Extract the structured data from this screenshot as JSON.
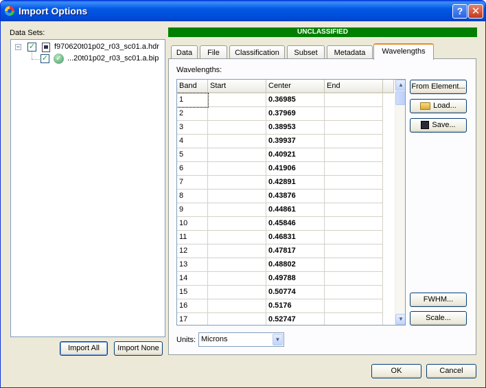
{
  "window": {
    "title": "Import Options",
    "help_glyph": "?",
    "close_glyph": "✕"
  },
  "datasets": {
    "label": "Data Sets:",
    "parent": {
      "name": "f970620t01p02_r03_sc01.a.hdr",
      "checked": true
    },
    "child": {
      "name": "...20t01p02_r03_sc01.a.bip",
      "checked": true
    },
    "import_all": "Import All",
    "import_none": "Import None"
  },
  "banner": "UNCLASSIFIED",
  "tabs": [
    "Data",
    "File",
    "Classification",
    "Subset",
    "Metadata",
    "Wavelengths"
  ],
  "active_tab": "Wavelengths",
  "wavelengths": {
    "label": "Wavelengths:",
    "columns": [
      "Band",
      "Start",
      "Center",
      "End"
    ],
    "rows": [
      {
        "band": "1",
        "start": "",
        "center": "0.36985",
        "end": ""
      },
      {
        "band": "2",
        "start": "",
        "center": "0.37969",
        "end": ""
      },
      {
        "band": "3",
        "start": "",
        "center": "0.38953",
        "end": ""
      },
      {
        "band": "4",
        "start": "",
        "center": "0.39937",
        "end": ""
      },
      {
        "band": "5",
        "start": "",
        "center": "0.40921",
        "end": ""
      },
      {
        "band": "6",
        "start": "",
        "center": "0.41906",
        "end": ""
      },
      {
        "band": "7",
        "start": "",
        "center": "0.42891",
        "end": ""
      },
      {
        "band": "8",
        "start": "",
        "center": "0.43876",
        "end": ""
      },
      {
        "band": "9",
        "start": "",
        "center": "0.44861",
        "end": ""
      },
      {
        "band": "10",
        "start": "",
        "center": "0.45846",
        "end": ""
      },
      {
        "band": "11",
        "start": "",
        "center": "0.46831",
        "end": ""
      },
      {
        "band": "12",
        "start": "",
        "center": "0.47817",
        "end": ""
      },
      {
        "band": "13",
        "start": "",
        "center": "0.48802",
        "end": ""
      },
      {
        "band": "14",
        "start": "",
        "center": "0.49788",
        "end": ""
      },
      {
        "band": "15",
        "start": "",
        "center": "0.50774",
        "end": ""
      },
      {
        "band": "16",
        "start": "",
        "center": "0.5176",
        "end": ""
      },
      {
        "band": "17",
        "start": "",
        "center": "0.52747",
        "end": ""
      }
    ],
    "from_element": "From Element...",
    "load": "Load...",
    "save": "Save...",
    "fwhm": "FWHM...",
    "scale": "Scale...",
    "units_label": "Units:",
    "units_value": "Microns"
  },
  "footer": {
    "ok": "OK",
    "cancel": "Cancel"
  },
  "colors": {
    "banner": "#008000",
    "title_bar": "#0058e6",
    "active_tab_accent": "#e68b2c"
  }
}
